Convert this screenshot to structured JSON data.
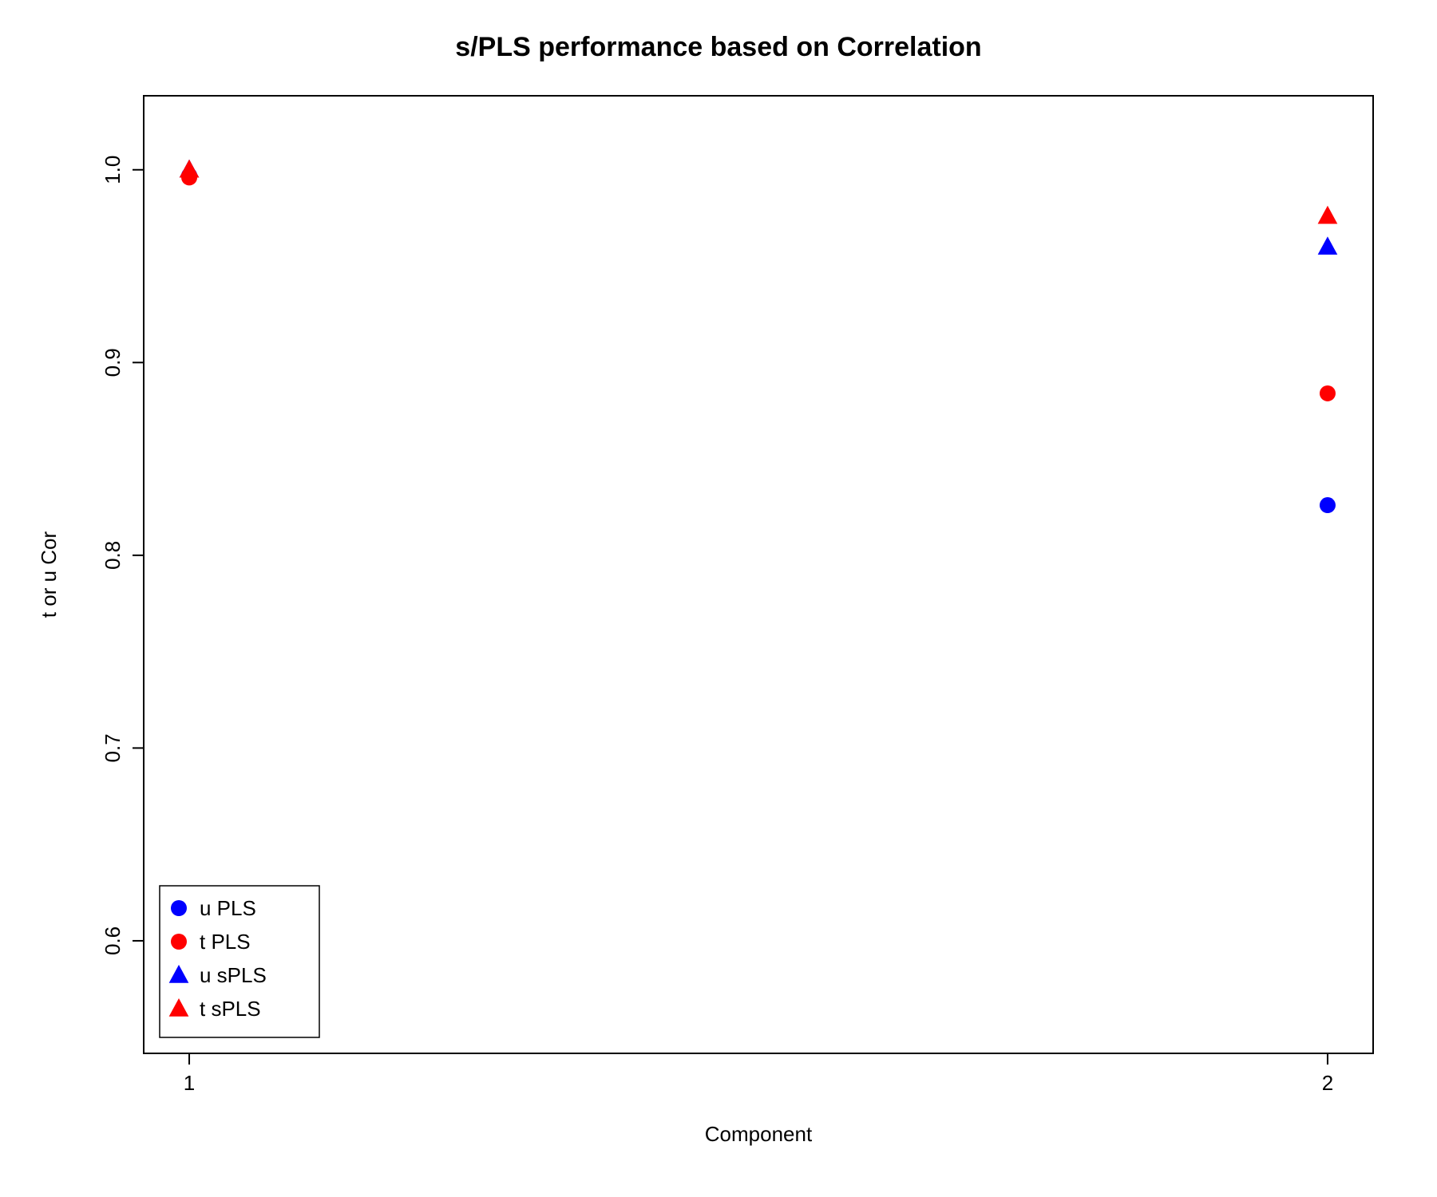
{
  "chart_data": {
    "type": "scatter",
    "title": "s/PLS performance based on Correlation",
    "xlabel": "Component",
    "ylabel": "t or u Cor",
    "xlim": [
      1,
      2
    ],
    "ylim": [
      0.56,
      1.02
    ],
    "x_ticks": [
      1,
      2
    ],
    "y_ticks": [
      0.6,
      0.7,
      0.8,
      0.9,
      1.0
    ],
    "series": [
      {
        "name": "u PLS",
        "color": "#0000FF",
        "shape": "circle",
        "x": [
          1,
          2
        ],
        "y": [
          0.997,
          0.826
        ]
      },
      {
        "name": "t PLS",
        "color": "#FF0000",
        "shape": "circle",
        "x": [
          1,
          2
        ],
        "y": [
          0.996,
          0.884
        ]
      },
      {
        "name": "u sPLS",
        "color": "#0000FF",
        "shape": "triangle",
        "x": [
          1,
          2
        ],
        "y": [
          1.0,
          0.96
        ]
      },
      {
        "name": "t sPLS",
        "color": "#FF0000",
        "shape": "triangle",
        "x": [
          1,
          2
        ],
        "y": [
          1.0,
          0.976
        ]
      }
    ],
    "legend_position": "bottomleft"
  }
}
